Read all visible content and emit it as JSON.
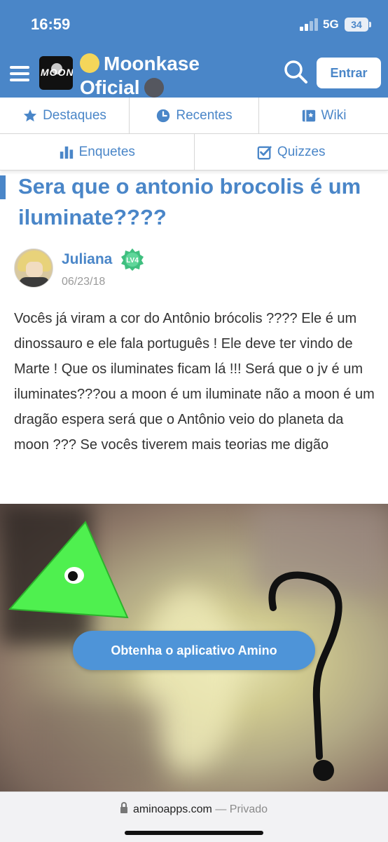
{
  "status_bar": {
    "time": "16:59",
    "network": "5G",
    "battery": "34"
  },
  "header": {
    "title_line1": "Moonkase",
    "title_line2": "Oficial",
    "logo_text": "MOON",
    "login_label": "Entrar",
    "background_color": "#4a86c8",
    "icons": [
      "menu-icon",
      "search-icon"
    ]
  },
  "tabs": [
    {
      "label": "Destaques",
      "icon": "star-icon"
    },
    {
      "label": "Recentes",
      "icon": "clock-icon"
    },
    {
      "label": "Wiki",
      "icon": "wiki-icon"
    },
    {
      "label": "Enquetes",
      "icon": "bar-chart-icon"
    },
    {
      "label": "Quizzes",
      "icon": "checkbox-icon"
    }
  ],
  "post": {
    "title": "Sera que o antonio brocolis é um iluminate????",
    "author": "Juliana",
    "level": "LV4",
    "date": "06/23/18",
    "body": "Vocês já viram a cor do Antônio brócolis ???? Ele é um dinossauro e ele fala português ! Ele deve ter vindo de Marte ! Que os iluminates ficam lá !!! Será que o jv é um iluminates???ou a moon é um iluminate não a moon é um dragão espera será que o Antônio veio do planeta da moon ??? Se vocês tiverem mais teorias me digão"
  },
  "cta": {
    "label": "Obtenha o aplicativo Amino"
  },
  "browser": {
    "url": "aminoapps.com",
    "separator": "—",
    "mode": "Privado"
  }
}
